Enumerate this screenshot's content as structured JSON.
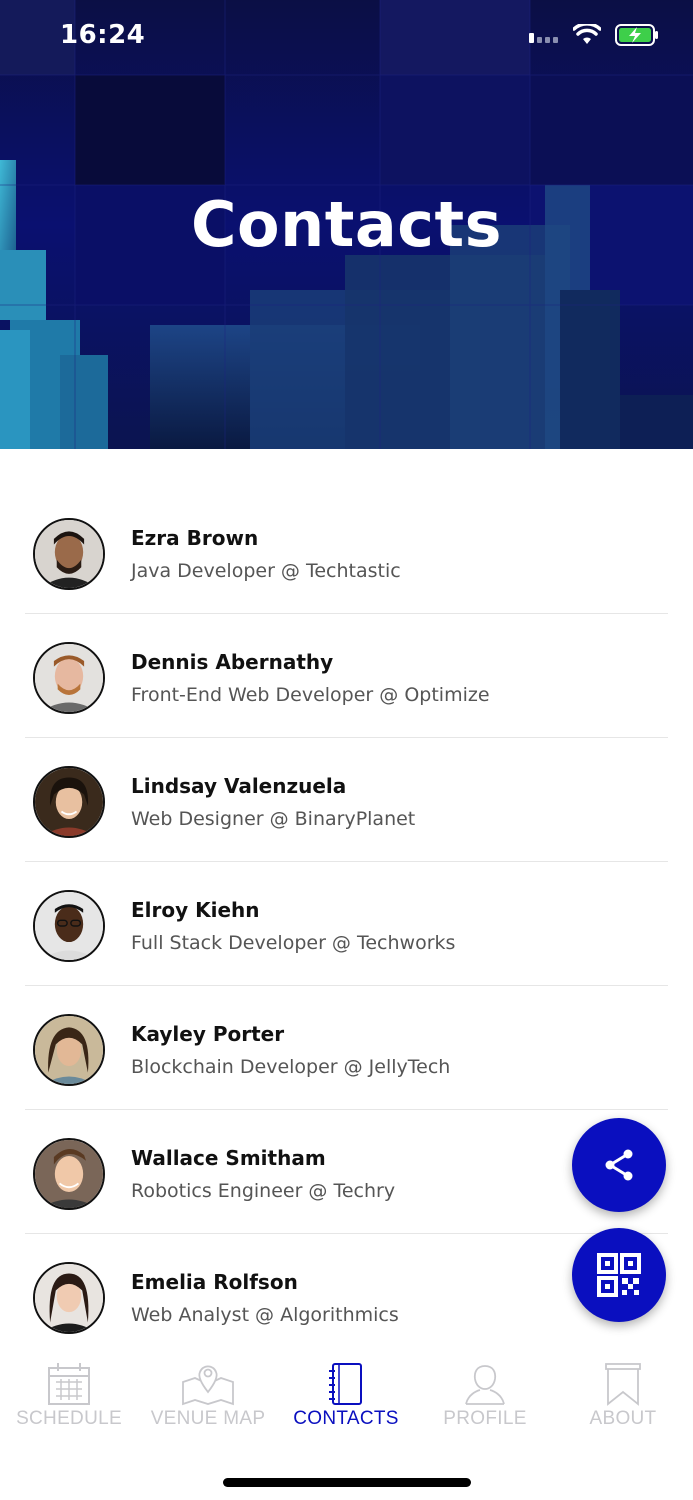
{
  "status_bar": {
    "time": "16:24"
  },
  "header": {
    "title": "Contacts"
  },
  "contacts": [
    {
      "name": "Ezra Brown",
      "role": "Java Developer @ Techtastic"
    },
    {
      "name": "Dennis Abernathy",
      "role": "Front-End Web Developer @ Optimize"
    },
    {
      "name": "Lindsay Valenzuela",
      "role": "Web Designer @ BinaryPlanet"
    },
    {
      "name": "Elroy Kiehn",
      "role": "Full Stack Developer @ Techworks"
    },
    {
      "name": "Kayley Porter",
      "role": "Blockchain Developer @ JellyTech"
    },
    {
      "name": "Wallace Smitham",
      "role": "Robotics Engineer @ Techry"
    },
    {
      "name": "Emelia Rolfson",
      "role": "Web Analyst @ Algorithmics"
    }
  ],
  "fabs": {
    "share_icon": "share-icon",
    "qr_icon": "qr-code-icon"
  },
  "tabs": [
    {
      "label": "SCHEDULE",
      "icon": "calendar-icon",
      "active": false
    },
    {
      "label": "VENUE MAP",
      "icon": "map-icon",
      "active": false
    },
    {
      "label": "CONTACTS",
      "icon": "notebook-icon",
      "active": true
    },
    {
      "label": "PROFILE",
      "icon": "person-icon",
      "active": false
    },
    {
      "label": "ABOUT",
      "icon": "bookmark-icon",
      "active": false
    }
  ],
  "colors": {
    "accent": "#0a0fbf",
    "header_bg": "#050a4e",
    "tab_inactive": "#c8c8cc"
  }
}
